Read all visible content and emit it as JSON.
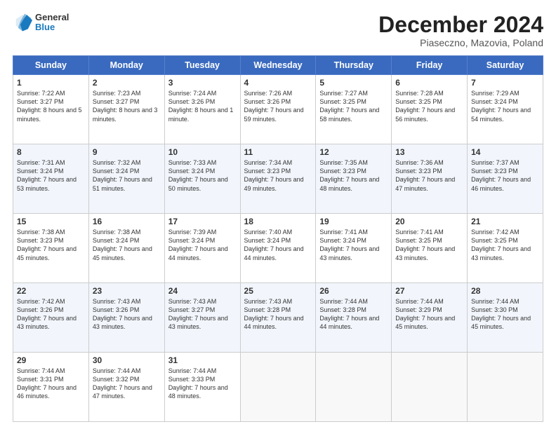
{
  "header": {
    "logo_line1": "General",
    "logo_line2": "Blue",
    "month": "December 2024",
    "location": "Piaseczno, Mazovia, Poland"
  },
  "days_of_week": [
    "Sunday",
    "Monday",
    "Tuesday",
    "Wednesday",
    "Thursday",
    "Friday",
    "Saturday"
  ],
  "weeks": [
    [
      {
        "day": "1",
        "sunrise": "7:22 AM",
        "sunset": "3:27 PM",
        "daylight": "8 hours and 5 minutes."
      },
      {
        "day": "2",
        "sunrise": "7:23 AM",
        "sunset": "3:27 PM",
        "daylight": "8 hours and 3 minutes."
      },
      {
        "day": "3",
        "sunrise": "7:24 AM",
        "sunset": "3:26 PM",
        "daylight": "8 hours and 1 minute."
      },
      {
        "day": "4",
        "sunrise": "7:26 AM",
        "sunset": "3:26 PM",
        "daylight": "7 hours and 59 minutes."
      },
      {
        "day": "5",
        "sunrise": "7:27 AM",
        "sunset": "3:25 PM",
        "daylight": "7 hours and 58 minutes."
      },
      {
        "day": "6",
        "sunrise": "7:28 AM",
        "sunset": "3:25 PM",
        "daylight": "7 hours and 56 minutes."
      },
      {
        "day": "7",
        "sunrise": "7:29 AM",
        "sunset": "3:24 PM",
        "daylight": "7 hours and 54 minutes."
      }
    ],
    [
      {
        "day": "8",
        "sunrise": "7:31 AM",
        "sunset": "3:24 PM",
        "daylight": "7 hours and 53 minutes."
      },
      {
        "day": "9",
        "sunrise": "7:32 AM",
        "sunset": "3:24 PM",
        "daylight": "7 hours and 51 minutes."
      },
      {
        "day": "10",
        "sunrise": "7:33 AM",
        "sunset": "3:24 PM",
        "daylight": "7 hours and 50 minutes."
      },
      {
        "day": "11",
        "sunrise": "7:34 AM",
        "sunset": "3:23 PM",
        "daylight": "7 hours and 49 minutes."
      },
      {
        "day": "12",
        "sunrise": "7:35 AM",
        "sunset": "3:23 PM",
        "daylight": "7 hours and 48 minutes."
      },
      {
        "day": "13",
        "sunrise": "7:36 AM",
        "sunset": "3:23 PM",
        "daylight": "7 hours and 47 minutes."
      },
      {
        "day": "14",
        "sunrise": "7:37 AM",
        "sunset": "3:23 PM",
        "daylight": "7 hours and 46 minutes."
      }
    ],
    [
      {
        "day": "15",
        "sunrise": "7:38 AM",
        "sunset": "3:23 PM",
        "daylight": "7 hours and 45 minutes."
      },
      {
        "day": "16",
        "sunrise": "7:38 AM",
        "sunset": "3:24 PM",
        "daylight": "7 hours and 45 minutes."
      },
      {
        "day": "17",
        "sunrise": "7:39 AM",
        "sunset": "3:24 PM",
        "daylight": "7 hours and 44 minutes."
      },
      {
        "day": "18",
        "sunrise": "7:40 AM",
        "sunset": "3:24 PM",
        "daylight": "7 hours and 44 minutes."
      },
      {
        "day": "19",
        "sunrise": "7:41 AM",
        "sunset": "3:24 PM",
        "daylight": "7 hours and 43 minutes."
      },
      {
        "day": "20",
        "sunrise": "7:41 AM",
        "sunset": "3:25 PM",
        "daylight": "7 hours and 43 minutes."
      },
      {
        "day": "21",
        "sunrise": "7:42 AM",
        "sunset": "3:25 PM",
        "daylight": "7 hours and 43 minutes."
      }
    ],
    [
      {
        "day": "22",
        "sunrise": "7:42 AM",
        "sunset": "3:26 PM",
        "daylight": "7 hours and 43 minutes."
      },
      {
        "day": "23",
        "sunrise": "7:43 AM",
        "sunset": "3:26 PM",
        "daylight": "7 hours and 43 minutes."
      },
      {
        "day": "24",
        "sunrise": "7:43 AM",
        "sunset": "3:27 PM",
        "daylight": "7 hours and 43 minutes."
      },
      {
        "day": "25",
        "sunrise": "7:43 AM",
        "sunset": "3:28 PM",
        "daylight": "7 hours and 44 minutes."
      },
      {
        "day": "26",
        "sunrise": "7:44 AM",
        "sunset": "3:28 PM",
        "daylight": "7 hours and 44 minutes."
      },
      {
        "day": "27",
        "sunrise": "7:44 AM",
        "sunset": "3:29 PM",
        "daylight": "7 hours and 45 minutes."
      },
      {
        "day": "28",
        "sunrise": "7:44 AM",
        "sunset": "3:30 PM",
        "daylight": "7 hours and 45 minutes."
      }
    ],
    [
      {
        "day": "29",
        "sunrise": "7:44 AM",
        "sunset": "3:31 PM",
        "daylight": "7 hours and 46 minutes."
      },
      {
        "day": "30",
        "sunrise": "7:44 AM",
        "sunset": "3:32 PM",
        "daylight": "7 hours and 47 minutes."
      },
      {
        "day": "31",
        "sunrise": "7:44 AM",
        "sunset": "3:33 PM",
        "daylight": "7 hours and 48 minutes."
      },
      null,
      null,
      null,
      null
    ]
  ]
}
